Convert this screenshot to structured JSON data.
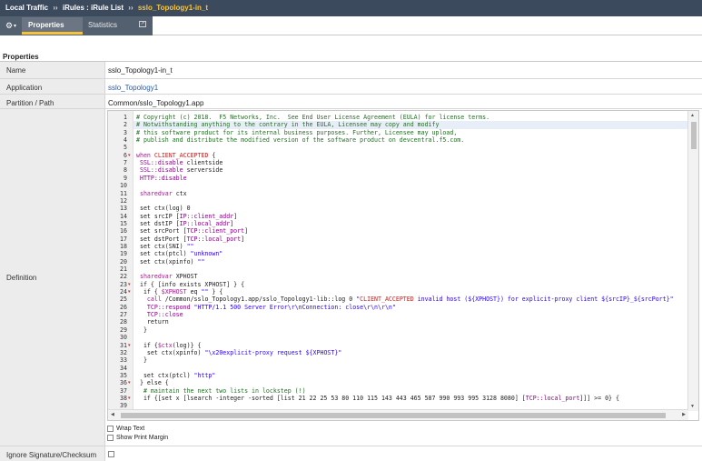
{
  "breadcrumb": {
    "items": [
      "Local Traffic",
      "iRules : iRule List",
      "sslo_Topology1-in_t"
    ],
    "separator": "››"
  },
  "tabs": [
    {
      "label": "Properties",
      "active": true
    },
    {
      "label": "Statistics",
      "active": false
    }
  ],
  "section_title": "Properties",
  "properties": {
    "name_label": "Name",
    "name_value": "sslo_Topology1-in_t",
    "application_label": "Application",
    "application_value": "sslo_Topology1",
    "partition_label": "Partition / Path",
    "partition_value": "Common/sslo_Topology1.app",
    "definition_label": "Definition",
    "ignore_label": "Ignore Signature/Checksum"
  },
  "editor": {
    "line_numbers": [
      "1",
      "2",
      "3",
      "4",
      "5",
      "6",
      "7",
      "8",
      "9",
      "10",
      "11",
      "12",
      "13",
      "14",
      "15",
      "16",
      "17",
      "18",
      "19",
      "20",
      "21",
      "22",
      "23",
      "24",
      "25",
      "26",
      "27",
      "28",
      "29",
      "30",
      "31",
      "32",
      "33",
      "34",
      "35",
      "36",
      "37",
      "38",
      "39"
    ],
    "lines": [
      "# Copyright (c) 2018.  F5 Networks, Inc.  See End User License Agreement (EULA) for license terms.",
      "# Notwithstanding anything to the contrary in the EULA, Licensee may copy and modify",
      "# this software product for its internal business purposes. Further, Licensee may upload,",
      "# publish and distribute the modified version of the software product on devcentral.f5.com.",
      "",
      "when CLIENT_ACCEPTED {",
      " SSL::disable clientside",
      " SSL::disable serverside",
      " HTTP::disable",
      "",
      " sharedvar ctx",
      "",
      " set ctx(log) 0",
      " set srcIP [IP::client_addr]",
      " set dstIP [IP::local_addr]",
      " set srcPort [TCP::client_port]",
      " set dstPort [TCP::local_port]",
      " set ctx(SNI) \"\"",
      " set ctx(ptcl) \"unknown\"",
      " set ctx(xpinfo) \"\"",
      "",
      " sharedvar XPHOST",
      " if { [info exists XPHOST] } {",
      "  if { $XPHOST eq \"\" } {",
      "   call /Common/sslo_Topology1.app/sslo_Topology1-lib::log 0 \"CLIENT_ACCEPTED invalid host (${XPHOST}) for explicit-proxy client ${srcIP}_${srcPort}\"",
      "   TCP::respond \"HTTP/1.1 500 Server Error\\r\\nConnection: close\\r\\n\\r\\n\"",
      "   TCP::close",
      "   return",
      "  }",
      "",
      "  if {$ctx(log)} {",
      "   set ctx(xpinfo) \"\\x20explicit-proxy request ${XPHOST}\"",
      "  }",
      "",
      "  set ctx(ptcl) \"http\"",
      " } else {",
      "  # maintain the next two lists in lockstep (!)",
      "  if {[set x [lsearch -integer -sorted [list 21 22 25 53 80 110 115 143 443 465 587 990 993 995 3128 8080] [TCP::local_port]]] >= 0} {",
      ""
    ],
    "fold_lines": [
      6,
      23,
      24,
      31,
      36,
      38
    ],
    "highlight_line": 2,
    "options": {
      "wrap_text_label": "Wrap Text",
      "show_print_margin_label": "Show Print Margin"
    }
  }
}
